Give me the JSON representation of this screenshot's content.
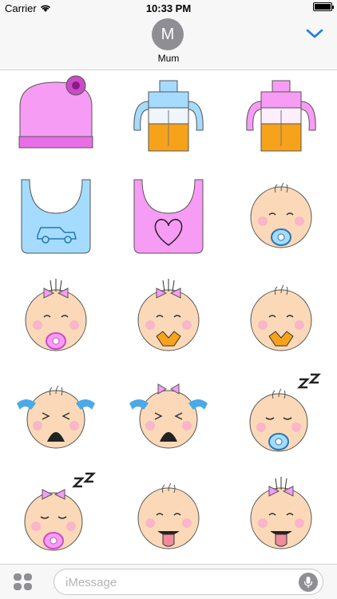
{
  "status_bar": {
    "carrier": "Carrier",
    "time": "10:33 PM"
  },
  "header": {
    "avatar_initial": "M",
    "contact_name": "Mum"
  },
  "stickers": [
    {
      "name": "pink-baby-hat-sticker"
    },
    {
      "name": "blue-sippy-cup-sticker"
    },
    {
      "name": "pink-sippy-cup-sticker"
    },
    {
      "name": "blue-bib-car-sticker"
    },
    {
      "name": "pink-bib-heart-sticker"
    },
    {
      "name": "baby-boy-pacifier-sticker"
    },
    {
      "name": "baby-girl-pacifier-sticker"
    },
    {
      "name": "baby-girl-teether-sticker"
    },
    {
      "name": "baby-boy-teether-sticker"
    },
    {
      "name": "baby-boy-crying-sticker"
    },
    {
      "name": "baby-girl-crying-sticker"
    },
    {
      "name": "baby-boy-sleeping-sticker"
    },
    {
      "name": "baby-girl-sleeping-sticker"
    },
    {
      "name": "baby-boy-tongue-sticker"
    },
    {
      "name": "baby-girl-tongue-sticker"
    }
  ],
  "compose": {
    "placeholder": "iMessage"
  },
  "colors": {
    "pink": "#f79cf4",
    "blue": "#a4dbff",
    "skin": "#fbd9b8",
    "juice": "#f7a21b"
  }
}
